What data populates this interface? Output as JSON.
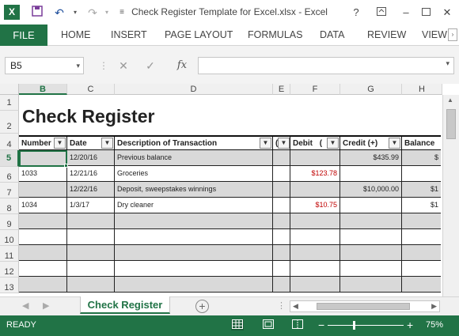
{
  "window": {
    "app_icon": "X",
    "title": "Check Register Template for Excel.xlsx - Excel",
    "help": "?",
    "minimize": "–",
    "close": "✕"
  },
  "qat": {
    "save_icon": "💾",
    "undo_icon": "↶",
    "redo_icon": "↷",
    "more_icon": "≡"
  },
  "ribbon": {
    "file": "FILE",
    "tabs": [
      "HOME",
      "INSERT",
      "PAGE LAYOUT",
      "FORMULAS",
      "DATA",
      "REVIEW",
      "VIEW"
    ]
  },
  "formula_bar": {
    "name_box": "B5",
    "cancel": "✕",
    "enter": "✓",
    "fx": "fx",
    "value": ""
  },
  "columns": [
    "B",
    "C",
    "D",
    "E",
    "F",
    "G",
    "H"
  ],
  "selected_column": "B",
  "rows": [
    "1",
    "2",
    "4",
    "5",
    "6",
    "7",
    "8",
    "9",
    "10",
    "11",
    "12",
    "13"
  ],
  "selected_row": "5",
  "sheet": {
    "title": "Check Register",
    "headers": {
      "number": "Number",
      "date": "Date",
      "description": "Description of Transaction",
      "e_col": "(",
      "debit": "Debit",
      "debit_extra": "(",
      "credit": "Credit (+)",
      "balance": "Balance"
    },
    "transactions": [
      {
        "number": "",
        "date": "12/20/16",
        "description": "Previous balance",
        "debit": "",
        "credit": "$435.99",
        "balance": "$"
      },
      {
        "number": "1033",
        "date": "12/21/16",
        "description": "Groceries",
        "debit": "$123.78",
        "credit": "",
        "balance": ""
      },
      {
        "number": "",
        "date": "12/22/16",
        "description": "Deposit, sweepstakes winnings",
        "debit": "",
        "credit": "$10,000.00",
        "balance": "$1"
      },
      {
        "number": "1034",
        "date": "1/3/17",
        "description": "Dry cleaner",
        "debit": "$10.75",
        "credit": "",
        "balance": "$1"
      }
    ]
  },
  "sheet_tabs": {
    "active": "Check Register",
    "add": "+"
  },
  "status": {
    "ready": "READY",
    "zoom": "75%",
    "zoom_level_percent": 75,
    "minus": "−",
    "plus": "+"
  },
  "colors": {
    "accent": "#217346",
    "debit_red": "#c00000",
    "gray_row": "#d9d9d9"
  }
}
